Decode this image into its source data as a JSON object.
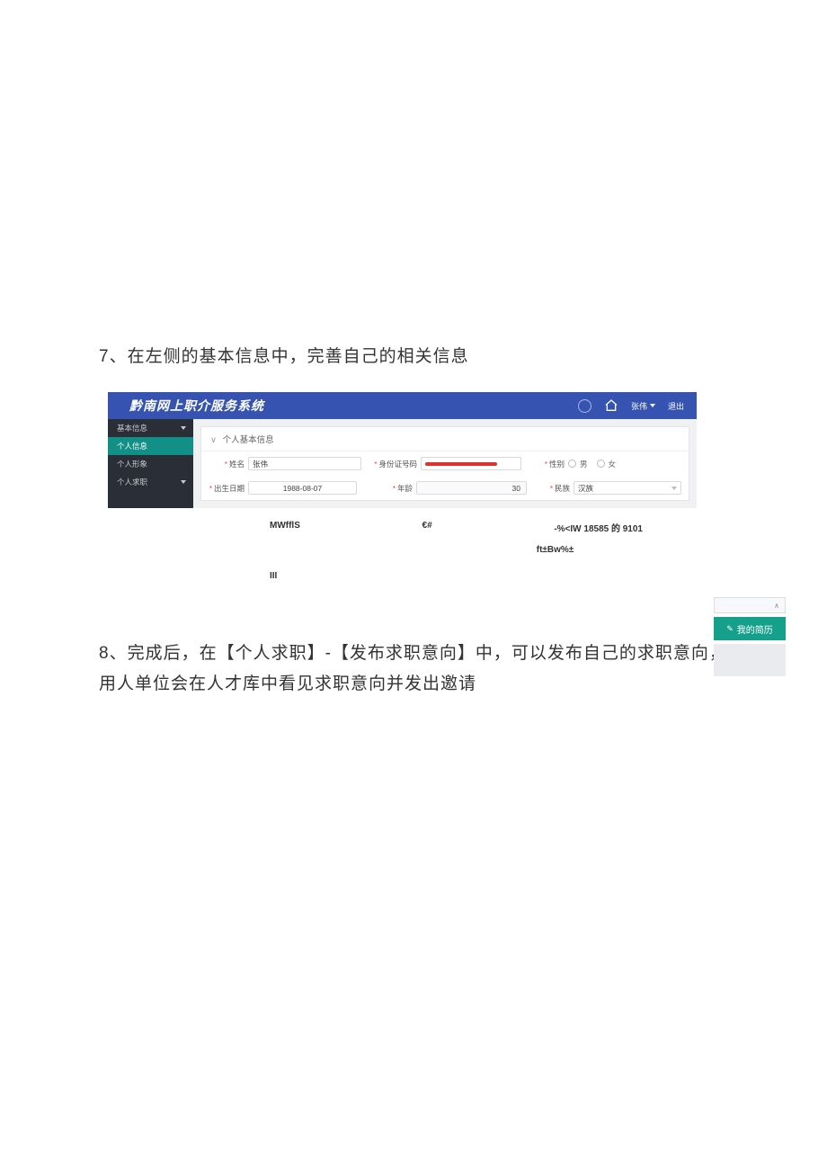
{
  "doc": {
    "step7": "7、在左侧的基本信息中，完善自己的相关信息",
    "step8": "8、完成后，在【个人求职】-【发布求职意向】中，可以发布自己的求职意向，用人单位会在人才库中看见求职意向并发出邀请"
  },
  "app": {
    "title": "黔南网上职介服务系统",
    "user_menu": "张伟",
    "logout": "退出",
    "sidebar": {
      "items": [
        "基本信息",
        "个人信息",
        "个人形象",
        "个人求职"
      ]
    },
    "panel_title": "个人基本信息",
    "form": {
      "name_label": "姓名",
      "name_value": "张伟",
      "id_label": "身份证号码",
      "gender_label": "性别",
      "gender_male": "男",
      "gender_female": "女",
      "birth_label": "出生日期",
      "birth_value": "1988-08-07",
      "age_label": "年龄",
      "age_value": "30",
      "nation_label": "民族",
      "nation_value": "汉族"
    }
  },
  "extra": {
    "row1_a": "MWfflS",
    "row1_b": "€#",
    "row1_c": "-%<IW 18585 的 9101",
    "row2": "ft±Bw%±",
    "row3": "III"
  },
  "float": {
    "scroll_hint": "∧",
    "resume_btn": "我的简历"
  }
}
